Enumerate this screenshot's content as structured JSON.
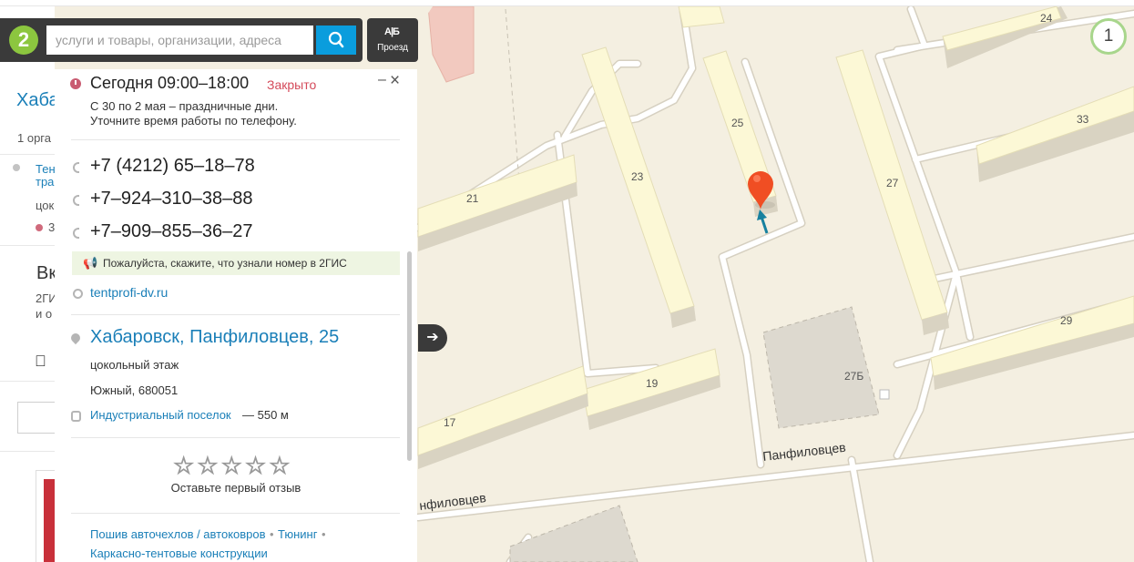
{
  "search": {
    "logo_text": "2",
    "placeholder": "услуги и товары, организации, адреса",
    "route_icon": "А|Б",
    "route_label": "Проезд"
  },
  "left_panel": {
    "title": "Хабар",
    "count": "1 орга",
    "item_name_1": "Тен",
    "item_name_2": "тра",
    "item_sub": "цокол",
    "item_hours_prefix": "3",
    "heading": "Вк",
    "desc_1": "2ГИ",
    "desc_2": "и о"
  },
  "card": {
    "hours": "Сегодня 09:00–18:00",
    "status": "Закрыто",
    "holiday_line1": "С 30 по 2 мая – праздничные дни.",
    "holiday_line2": "Уточните время работы по телефону.",
    "phones": [
      "+7 (4212) 65–18–78",
      "+7–924–310–38–88",
      "+7–909–855–36–27"
    ],
    "notice": "Пожалуйста, скажите, что узнали номер в 2ГИС",
    "website": "tentprofi-dv.ru",
    "address": "Хабаровск, Панфиловцев, 25",
    "floor": "цокольный этаж",
    "district": "Южный, 680051",
    "stop": "Индустриальный поселок",
    "stop_distance": "— 550 м",
    "stars": "☆☆☆☆☆",
    "rating": 0,
    "first_review": "Оставьте первый отзыв",
    "rubrics": [
      "Пошив авточехлов / автоковров",
      "Тюнинг",
      "Каркасно-тентовые конструкции"
    ]
  },
  "map": {
    "counter": "1",
    "street": "Панфиловцев",
    "street_partial": "нфиловцев",
    "house_numbers": [
      "24",
      "25",
      "33",
      "23",
      "27",
      "21",
      "29",
      "27Б",
      "19",
      "17"
    ]
  },
  "colors": {
    "accent": "#1a7fb8",
    "closed": "#d44a5a",
    "search_button": "#0a9ddd",
    "marker": "#f04e23",
    "logo": "#8cc63f"
  }
}
